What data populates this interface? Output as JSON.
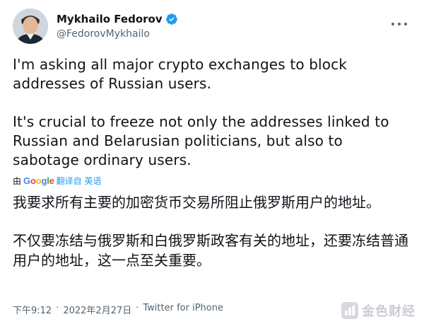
{
  "author": {
    "display_name": "Mykhailo Fedorov",
    "handle": "@FedorovMykhailo"
  },
  "tweet": {
    "paragraph_1": "I'm asking all major crypto exchanges to block addresses of Russian users.",
    "paragraph_2": "It's crucial to freeze not only the addresses linked to Russian and Belarusian politicians, but also to sabotage ordinary users."
  },
  "translation": {
    "prefix": "由",
    "google": "Google",
    "label": "翻译自 英语",
    "paragraph_1": "我要求所有主要的加密货币交易所阻止俄罗斯用户的地址。",
    "paragraph_2": "不仅要冻结与俄罗斯和白俄罗斯政客有关的地址，还要冻结普通用户的地址，这一点至关重要。"
  },
  "meta": {
    "time": "下午9:12",
    "date": "2022年2月27日",
    "separator": "·",
    "source": "Twitter for iPhone"
  },
  "watermark": {
    "text": "金色财经"
  },
  "colors": {
    "accent": "#1d9bf0",
    "text": "#0f1419",
    "secondary": "#536471"
  },
  "icons": {
    "verified": "verified-badge-icon",
    "more": "more-options-icon"
  }
}
